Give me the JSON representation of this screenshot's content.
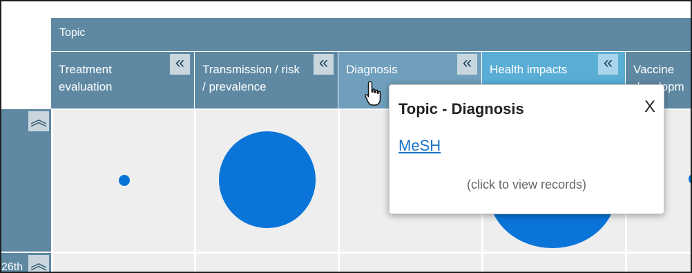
{
  "header": {
    "topic_label": "Topic"
  },
  "columns": [
    {
      "line1": "Treatment",
      "line2": "evaluation",
      "bg": "#5f89a3"
    },
    {
      "line1": "Transmission / risk",
      "line2": "/ prevalence",
      "bg": "#5f89a3"
    },
    {
      "line1": "Diagnosis",
      "line2": "",
      "bg": "#6f9fbc"
    },
    {
      "line1": "Health impacts",
      "line2": "",
      "bg": "#5aaed6"
    },
    {
      "line1": "Vaccine",
      "line2": "developm",
      "bg": "#5f89a3"
    }
  ],
  "collapse_glyph_horizontal": "«",
  "collapse_glyph_vertical": "︽",
  "rows": [
    {
      "label": ""
    },
    {
      "label": "26th"
    }
  ],
  "bubbles": {
    "treatment_evaluation": "small",
    "transmission_risk_prevalence": "large",
    "health_impacts": "large",
    "vaccine_development": "small"
  },
  "popup": {
    "title": "Topic - Diagnosis",
    "close_label": "X",
    "link_label": "MeSH",
    "hint": "(click to view records)"
  },
  "colors": {
    "header_bg": "#5f89a3",
    "header_hover": "#6f9fbc",
    "header_active": "#5aaed6",
    "bubble": "#0a74d9",
    "cell_bg": "#eeeeee",
    "link": "#1a73c9"
  }
}
